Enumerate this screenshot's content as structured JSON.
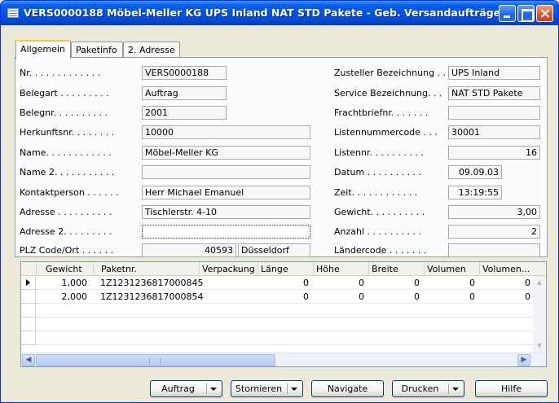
{
  "window": {
    "title": "VERS0000188 Möbel-Meller KG UPS Inland NAT STD Pakete - Geb. Versandaufträge"
  },
  "tabs": [
    {
      "label": "Allgemein",
      "active": true
    },
    {
      "label": "Paketinfo",
      "active": false
    },
    {
      "label": "2. Adresse",
      "active": false
    }
  ],
  "left_fields": [
    {
      "label": "Nr. . . . . . . . . . . . .",
      "value": "VERS0000188"
    },
    {
      "label": "Belegart . . . . . . . . .",
      "value": "Auftrag"
    },
    {
      "label": "Belegnr. . . . . . . . . .",
      "value": "2001"
    },
    {
      "label": "Herkunftsnr. . . . . . . .",
      "value": "10000"
    },
    {
      "label": "Name. . . . . . . . . . . .",
      "value": "Möbel-Meller KG"
    },
    {
      "label": "Name 2. . . . . . . . . . .",
      "value": ""
    },
    {
      "label": "Kontaktperson . . . . . .",
      "value": "Herr Michael Emanuel"
    },
    {
      "label": "Adresse . . . . . . . . . .",
      "value": "Tischlerstr. 4-10"
    },
    {
      "label": "Adresse 2. . . . . . . . .",
      "value": ""
    }
  ],
  "plz": {
    "label": "PLZ Code/Ort . . . . . .",
    "code": "40593",
    "city": "Düsseldorf"
  },
  "right_fields": [
    {
      "label": "Zusteller Bezeichnung . .",
      "value": "UPS Inland"
    },
    {
      "label": "Service Bezeichnung. . .",
      "value": "NAT STD Pakete"
    },
    {
      "label": "Frachtbriefnr. . . . . . .",
      "value": ""
    },
    {
      "label": "Listennummercode . . .",
      "value": "30001"
    },
    {
      "label": "Listennr. . . . . . . . . .",
      "value": "16"
    },
    {
      "label": "Datum . . . . . . . . . .",
      "value": "09.09.03"
    },
    {
      "label": "Zeit. . . . . . . . . . . .",
      "value": "13:19:55"
    },
    {
      "label": "Gewicht. . . . . . . . . .",
      "value": "3,00"
    },
    {
      "label": "Anzahl . . . . . . . . . .",
      "value": "2"
    },
    {
      "label": "Ländercode . . . . . . .",
      "value": ""
    }
  ],
  "table": {
    "columns": [
      "Gewicht",
      "Paketnr.",
      "Verpackung",
      "Länge",
      "Höhe",
      "Breite",
      "Volumen",
      "Volumen..."
    ],
    "rows": [
      [
        "1,000",
        "1Z1231236817000845",
        "",
        "0",
        "0",
        "0",
        "0",
        "0"
      ],
      [
        "2,000",
        "1Z1231236817000854",
        "",
        "0",
        "0",
        "0",
        "0",
        "0"
      ]
    ]
  },
  "buttons": {
    "auftrag": "Auftrag",
    "stornieren": "Stornieren",
    "navigate": "Navigate",
    "drucken": "Drucken",
    "hilfe": "Hilfe"
  },
  "icons": {
    "window": "form-icon",
    "minimize": "minimize-icon",
    "maximize": "maximize-icon",
    "close": "close-icon"
  },
  "colors": {
    "titlebar": "#0054e3",
    "tab_highlight": "#ffc83c",
    "close_button": "#e0562a"
  }
}
